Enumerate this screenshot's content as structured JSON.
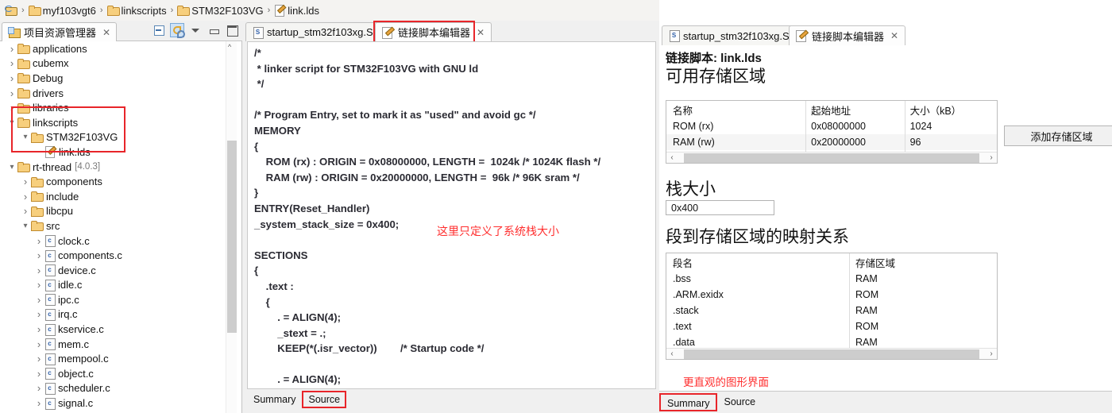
{
  "breadcrumb": {
    "items": [
      {
        "label": "",
        "icon": "project-icon"
      },
      {
        "label": "myf103vgt6",
        "icon": "folder-icon"
      },
      {
        "label": "linkscripts",
        "icon": "folder-icon"
      },
      {
        "label": "STM32F103VG",
        "icon": "folder-icon"
      },
      {
        "label": "link.lds",
        "icon": "lds-file-icon"
      }
    ],
    "separator": "›"
  },
  "explorer": {
    "tab_label": "项目资源管理器",
    "close_glyph": "✕",
    "toolbar": [
      {
        "name": "collapse-all-icon",
        "title": "Collapse All"
      },
      {
        "name": "link-with-editor-icon",
        "title": "Link with Editor"
      },
      {
        "name": "view-menu-icon",
        "title": "View Menu"
      },
      {
        "name": "minimize-icon",
        "title": "Minimize"
      },
      {
        "name": "maximize-icon",
        "title": "Maximize"
      }
    ],
    "tree": [
      {
        "label": "applications",
        "indent": 1,
        "state": "closed",
        "icon": "folder-icon"
      },
      {
        "label": "cubemx",
        "indent": 1,
        "state": "closed",
        "icon": "folder-icon"
      },
      {
        "label": "Debug",
        "indent": 1,
        "state": "closed",
        "icon": "folder-icon"
      },
      {
        "label": "drivers",
        "indent": 1,
        "state": "closed",
        "icon": "folder-icon"
      },
      {
        "label": "libraries",
        "indent": 1,
        "state": "closed",
        "icon": "folder-icon"
      },
      {
        "label": "linkscripts",
        "indent": 1,
        "state": "open",
        "icon": "folder-icon"
      },
      {
        "label": "STM32F103VG",
        "indent": 2,
        "state": "open",
        "icon": "folder-icon"
      },
      {
        "label": "link.lds",
        "indent": 3,
        "state": "none",
        "icon": "lds-file-icon"
      },
      {
        "label": "rt-thread",
        "indent": 1,
        "state": "open",
        "icon": "folder-icon",
        "version": "[4.0.3]"
      },
      {
        "label": "components",
        "indent": 2,
        "state": "closed",
        "icon": "folder-icon"
      },
      {
        "label": "include",
        "indent": 2,
        "state": "closed",
        "icon": "folder-icon"
      },
      {
        "label": "libcpu",
        "indent": 2,
        "state": "closed",
        "icon": "folder-icon"
      },
      {
        "label": "src",
        "indent": 2,
        "state": "open",
        "icon": "folder-icon"
      },
      {
        "label": "clock.c",
        "indent": 3,
        "state": "closed",
        "icon": "c-file-icon"
      },
      {
        "label": "components.c",
        "indent": 3,
        "state": "closed",
        "icon": "c-file-icon"
      },
      {
        "label": "device.c",
        "indent": 3,
        "state": "closed",
        "icon": "c-file-icon"
      },
      {
        "label": "idle.c",
        "indent": 3,
        "state": "closed",
        "icon": "c-file-icon"
      },
      {
        "label": "ipc.c",
        "indent": 3,
        "state": "closed",
        "icon": "c-file-icon"
      },
      {
        "label": "irq.c",
        "indent": 3,
        "state": "closed",
        "icon": "c-file-icon"
      },
      {
        "label": "kservice.c",
        "indent": 3,
        "state": "closed",
        "icon": "c-file-icon"
      },
      {
        "label": "mem.c",
        "indent": 3,
        "state": "closed",
        "icon": "c-file-icon"
      },
      {
        "label": "mempool.c",
        "indent": 3,
        "state": "closed",
        "icon": "c-file-icon"
      },
      {
        "label": "object.c",
        "indent": 3,
        "state": "closed",
        "icon": "c-file-icon"
      },
      {
        "label": "scheduler.c",
        "indent": 3,
        "state": "closed",
        "icon": "c-file-icon"
      },
      {
        "label": "signal.c",
        "indent": 3,
        "state": "closed",
        "icon": "c-file-icon"
      }
    ]
  },
  "editor": {
    "tabs": [
      {
        "label": "startup_stm32f103xg.S",
        "icon": "asm-file-icon",
        "active": false
      },
      {
        "label": "链接脚本编辑器",
        "icon": "link-script-editor-icon",
        "active": true,
        "highlighted": true
      }
    ],
    "close_glyph": "✕",
    "code_lines": [
      "/*",
      " * linker script for STM32F103VG with GNU ld",
      " */",
      "",
      "/* Program Entry, set to mark it as \"used\" and avoid gc */",
      "MEMORY",
      "{",
      "    ROM (rx) : ORIGIN = 0x08000000, LENGTH =  1024k /* 1024K flash */",
      "    RAM (rw) : ORIGIN = 0x20000000, LENGTH =  96k /* 96K sram */",
      "}",
      "ENTRY(Reset_Handler)",
      "_system_stack_size = 0x400;",
      "",
      "SECTIONS",
      "{",
      "    .text :",
      "    {",
      "        . = ALIGN(4);",
      "        _stext = .;",
      "        KEEP(*(.isr_vector))        /* Startup code */",
      "",
      "        . = ALIGN(4);"
    ],
    "annotation": "这里只定义了系统栈大小",
    "bottom_tabs": [
      {
        "label": "Summary",
        "highlighted": false
      },
      {
        "label": "Source",
        "highlighted": true
      }
    ]
  },
  "summary_panel": {
    "tabs": [
      {
        "label": "startup_stm32f103xg.S",
        "icon": "asm-file-icon",
        "active": false
      },
      {
        "label": "链接脚本编辑器",
        "icon": "link-script-editor-icon",
        "active": true
      }
    ],
    "close_glyph": "✕",
    "title": "链接脚本: link.lds",
    "memory_section": {
      "heading": "可用存储区域",
      "columns": [
        "名称",
        "起始地址",
        "大小（kB）"
      ],
      "rows": [
        [
          "ROM (rx)",
          "0x08000000",
          "1024"
        ],
        [
          "RAM (rw)",
          "0x20000000",
          "96"
        ]
      ],
      "add_button": "添加存储区域"
    },
    "stack_section": {
      "heading": "栈大小",
      "value": "0x400"
    },
    "mapping_section": {
      "heading": "段到存储区域的映射关系",
      "columns": [
        "段名",
        "存储区域"
      ],
      "rows": [
        [
          ".bss",
          "RAM"
        ],
        [
          ".ARM.exidx",
          "ROM"
        ],
        [
          ".stack",
          "RAM"
        ],
        [
          ".text",
          "ROM"
        ],
        [
          ".data",
          "RAM"
        ]
      ]
    },
    "annotation": "更直观的图形界面",
    "bottom_tabs": [
      {
        "label": "Summary",
        "highlighted": true
      },
      {
        "label": "Source",
        "highlighted": false
      }
    ],
    "scroll_arrows": {
      "left": "‹",
      "right": "›"
    }
  },
  "colors": {
    "annotation_red": "#ff2f2f",
    "highlight_box_red": "#e8252a",
    "tab_active_bg": "#fdfdfd",
    "panel_bg": "#f0f0f0"
  }
}
